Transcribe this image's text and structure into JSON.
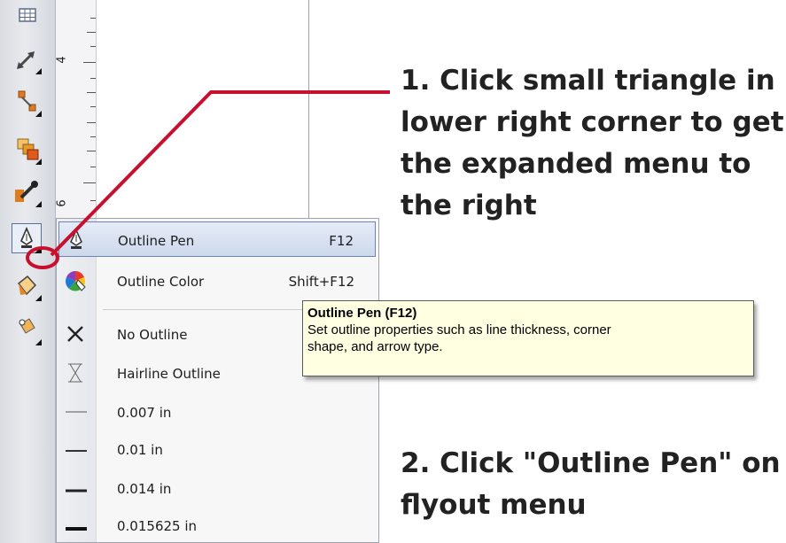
{
  "ruler": {
    "labels": [
      "4",
      "6"
    ]
  },
  "flyout": {
    "items": [
      {
        "label": "Outline Pen",
        "shortcut": "F12",
        "icon": "outline-pen-icon"
      },
      {
        "label": "Outline Color",
        "shortcut": "Shift+F12",
        "icon": "color-wheel-icon"
      },
      {
        "label": "No Outline",
        "shortcut": "",
        "icon": "x-icon"
      },
      {
        "label": "Hairline Outline",
        "shortcut": "",
        "icon": "hairline-icon"
      },
      {
        "label": "0.007 in",
        "shortcut": "",
        "icon": "line-weight-icon"
      },
      {
        "label": "0.01 in",
        "shortcut": "",
        "icon": "line-weight-icon"
      },
      {
        "label": "0.014 in",
        "shortcut": "",
        "icon": "line-weight-icon"
      },
      {
        "label": "0.015625 in",
        "shortcut": "",
        "icon": "line-weight-icon"
      }
    ]
  },
  "tooltip": {
    "title": "Outline Pen (F12)",
    "line1": "Set outline properties such as line thickness, corner",
    "line2": "shape, and arrow type."
  },
  "annotations": {
    "step1": [
      "1. Click small triangle in",
      "lower right corner to get",
      "the expanded menu to",
      "the right"
    ],
    "step2": [
      "2. Click \"Outline Pen\" on",
      "flyout menu"
    ]
  },
  "colors": {
    "annotation_red": "#c8102e",
    "highlight_border": "#6f83ad",
    "tooltip_bg": "#ffffe2"
  }
}
